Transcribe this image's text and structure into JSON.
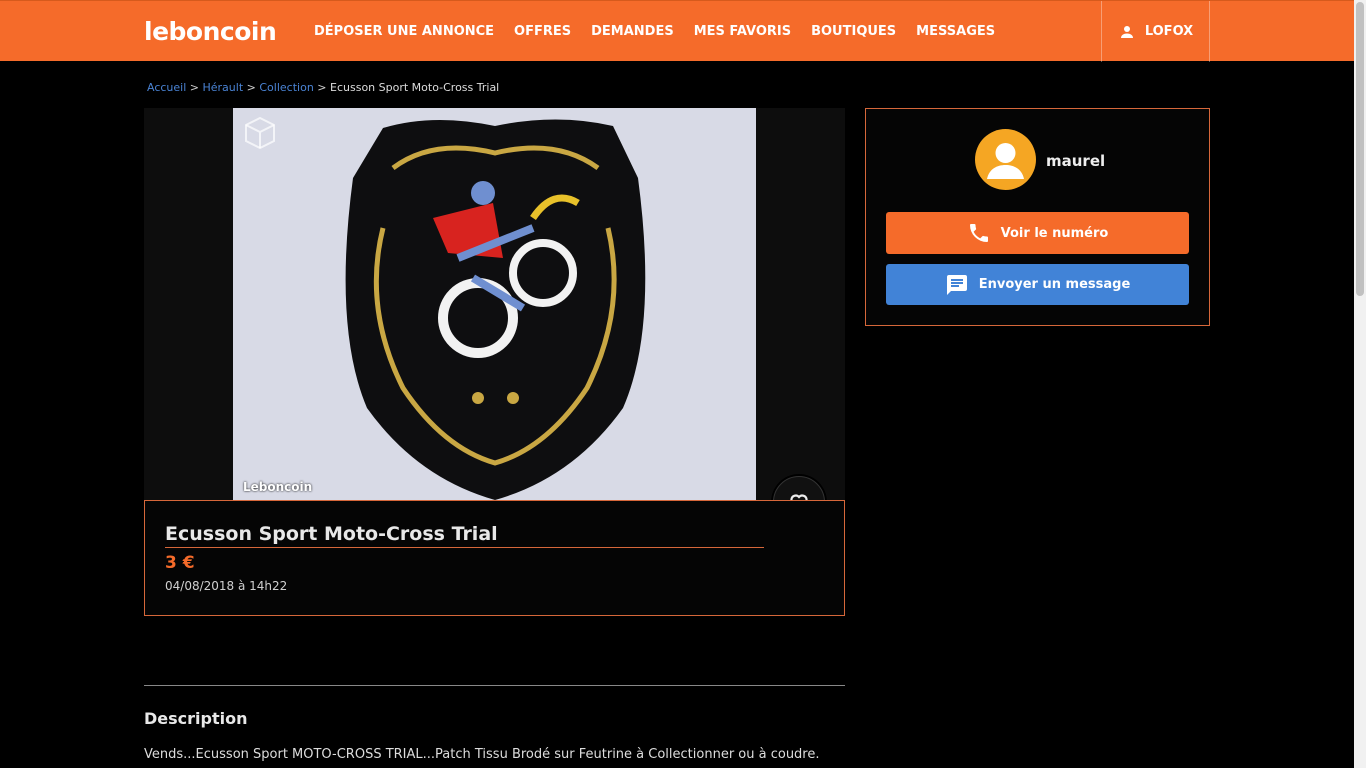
{
  "header": {
    "logo": "leboncoin",
    "nav": [
      "DÉPOSER UNE ANNONCE",
      "OFFRES",
      "DEMANDES",
      "MES FAVORIS",
      "BOUTIQUES",
      "MESSAGES"
    ],
    "user": "LOFOX"
  },
  "breadcrumb": {
    "home": "Accueil",
    "region": "Hérault",
    "category": "Collection",
    "current": "Ecusson Sport Moto-Cross Trial",
    "separator": ">"
  },
  "gallery": {
    "watermark": "Leboncoin"
  },
  "ad": {
    "title": "Ecusson Sport Moto-Cross Trial",
    "price": "3 €",
    "date": "04/08/2018 à 14h22"
  },
  "description": {
    "heading": "Description",
    "text": "Vends...Ecusson Sport MOTO-CROSS TRIAL...Patch Tissu Brodé sur Feutrine à Collectionner ou à coudre."
  },
  "seller": {
    "name": "maurel",
    "phone_label": "Voir le numéro",
    "message_label": "Envoyer un message"
  },
  "colors": {
    "brand": "#f56b2a",
    "message_button": "#4183d7",
    "avatar": "#f5a623"
  },
  "icons": {
    "user": "user-icon",
    "phone": "phone-icon",
    "message": "chat-icon",
    "favorite": "heart-icon"
  }
}
